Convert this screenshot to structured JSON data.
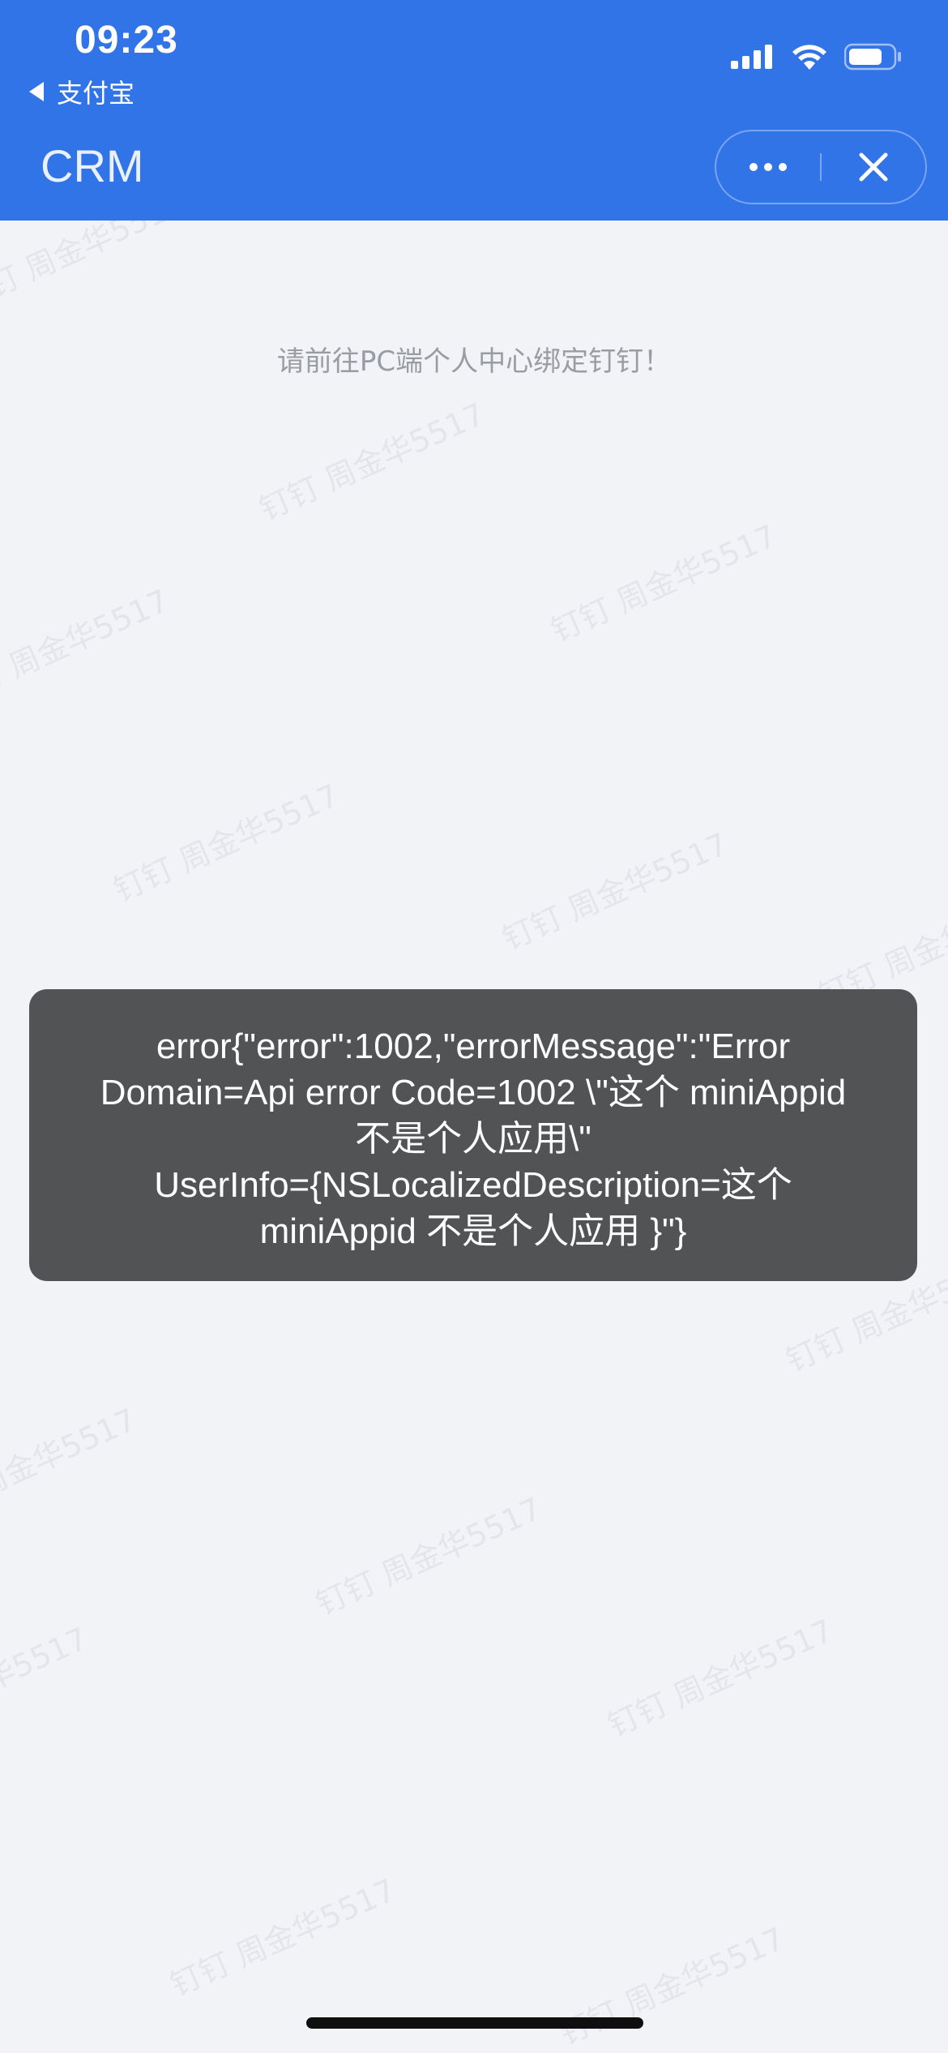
{
  "status_bar": {
    "time": "09:23",
    "back_app_label": "支付宝",
    "icons": [
      "cellular-signal-icon",
      "wifi-icon",
      "battery-icon"
    ]
  },
  "nav": {
    "title": "CRM",
    "more_icon": "more-dots-icon",
    "close_icon": "close-icon"
  },
  "content": {
    "hint": "请前往PC端个人中心绑定钉钉！"
  },
  "watermark": {
    "text": "钉钉   周金华5517"
  },
  "toast": {
    "lines": [
      "error{\"error\":1002,\"errorMessage\":\"Error",
      "Domain=Api error Code=1002 \\\"这个 miniAppid",
      "不是个人应用\\\"",
      "UserInfo={NSLocalizedDescription=这个",
      "miniAppid 不是个人应用 }\"}"
    ]
  },
  "colors": {
    "header": "#3174e8",
    "background": "#f2f3f7",
    "toast": "#525355"
  }
}
